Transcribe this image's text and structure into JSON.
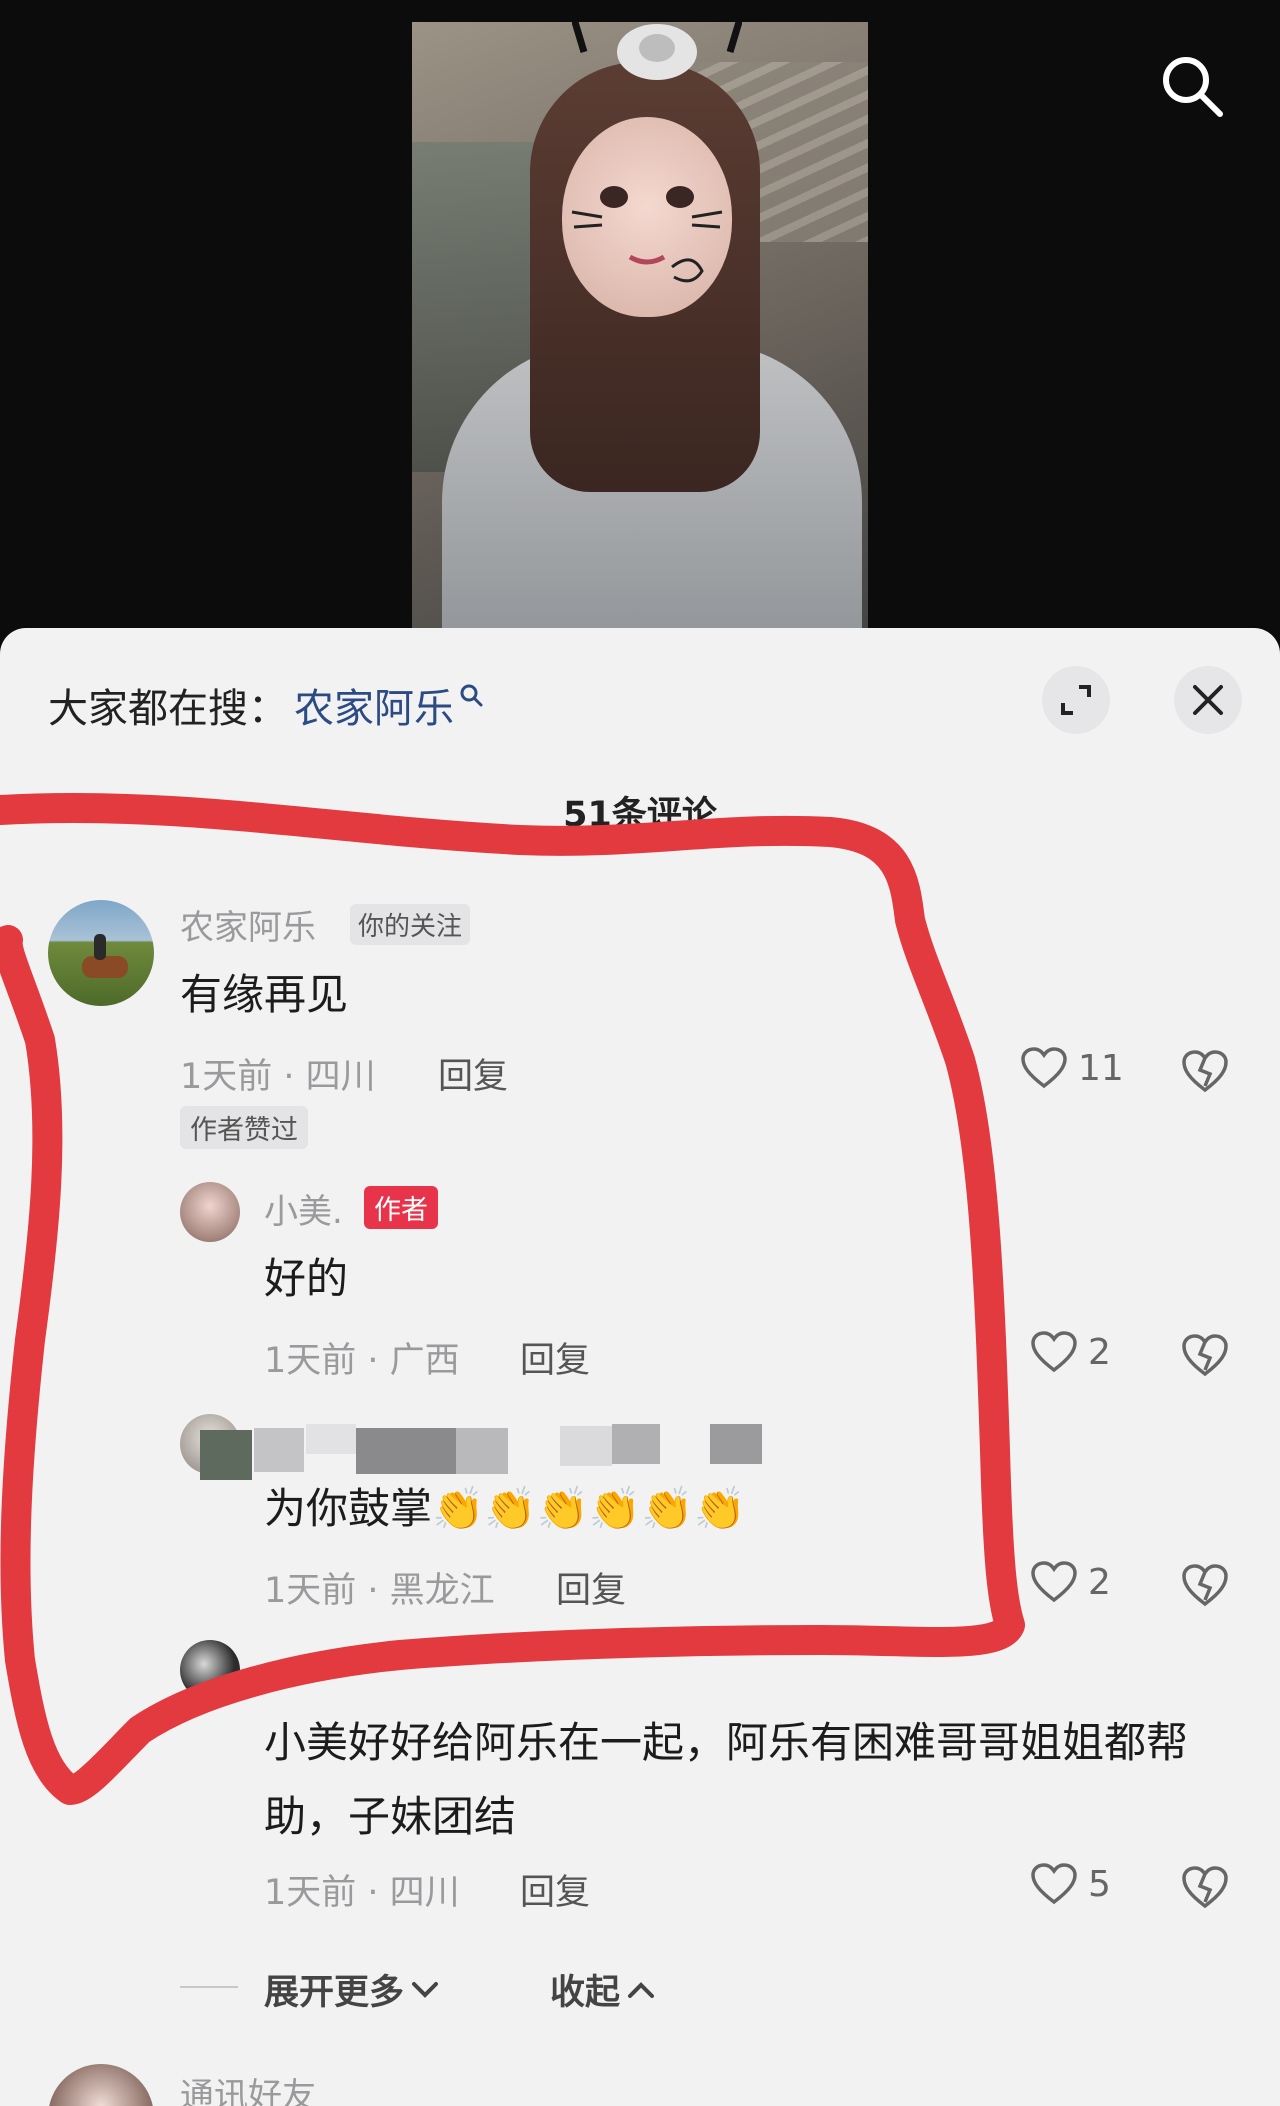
{
  "sheet": {
    "suggest_prefix": "大家都在搜：",
    "suggest_term": "农家阿乐",
    "comment_count": "51条评论"
  },
  "comments": [
    {
      "username": "农家阿乐",
      "tag": "你的关注",
      "content": "有缘再见",
      "meta": "1天前 · 四川",
      "reply": "回复",
      "likes": "11",
      "badge": "作者赞过"
    },
    {
      "username": "小美.",
      "tag": "作者",
      "content": "好的",
      "meta": "1天前 · 广西",
      "reply": "回复",
      "likes": "2"
    },
    {
      "username": "",
      "content": "为你鼓掌👏👏👏👏👏👏",
      "meta": "1天前 · 黑龙江",
      "reply": "回复",
      "likes": "2"
    },
    {
      "username": "",
      "content": "小美好好给阿乐在一起，阿乐有困难哥哥姐姐都帮助，子妹团结",
      "meta": "1天前 · 四川",
      "reply": "回复",
      "likes": "5"
    }
  ],
  "thread_controls": {
    "expand_more": "展开更多",
    "collapse": "收起"
  },
  "next_comment": {
    "username": "通讯好友"
  },
  "colors": {
    "sheet_bg": "#f2f2f3",
    "link": "#2b4b82",
    "author_tag": "#e8344a",
    "annotation": "#e23a3f"
  }
}
